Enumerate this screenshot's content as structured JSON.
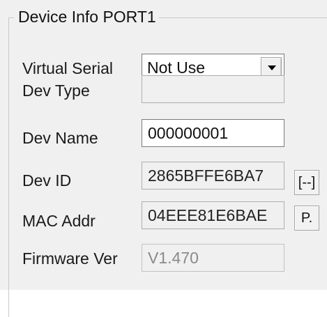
{
  "group": {
    "title": "Device Info PORT1"
  },
  "virtual_serial": {
    "label": "Virtual Serial",
    "value": "Not Use"
  },
  "dev_type": {
    "label": "Dev Type",
    "value": ""
  },
  "dev_name": {
    "label": "Dev Name",
    "value": "000000001"
  },
  "dev_id": {
    "label": "Dev ID",
    "value": "2865BFFE6BA7",
    "button_label": "[--]"
  },
  "mac_addr": {
    "label": "MAC Addr",
    "value": "04EEE81E6BAE",
    "button_label": "P."
  },
  "firmware_ver": {
    "label": "Firmware Ver",
    "value": "V1.470"
  }
}
